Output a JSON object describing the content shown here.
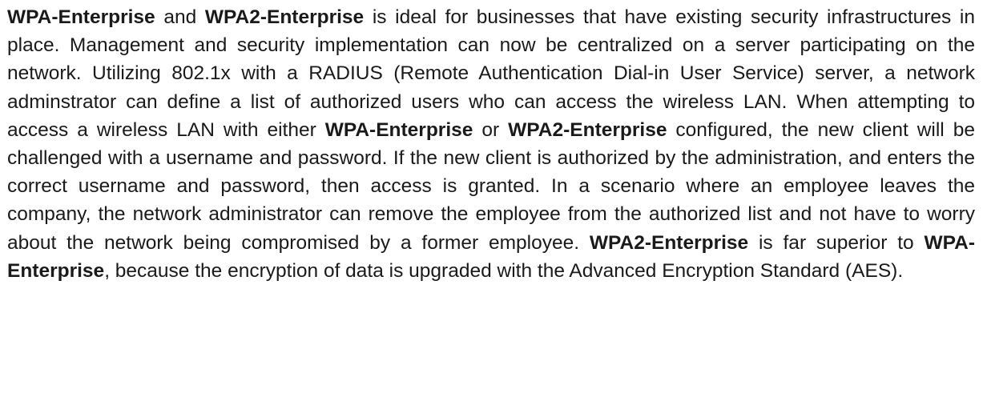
{
  "paragraph": {
    "segments": [
      {
        "text": "WPA-Enterprise",
        "bold": true
      },
      {
        "text": " and ",
        "bold": false
      },
      {
        "text": "WPA2-Enterprise",
        "bold": true
      },
      {
        "text": " is ideal for businesses that have existing security infrastructures in place. Management and security implementation can now be centralized on a server participating on the network. Utilizing 802.1x with a RADIUS (Remote Authentication Dial-in User Service) server, a network adminstrator can define a list of authorized users who can access the wireless LAN. When attempting to access a wireless LAN with either ",
        "bold": false
      },
      {
        "text": "WPA-Enterprise",
        "bold": true
      },
      {
        "text": " or ",
        "bold": false
      },
      {
        "text": "WPA2-Enterprise",
        "bold": true
      },
      {
        "text": " configured, the new client will be challenged with a username and password. If the new client is authorized by the administration, and enters the correct username and password, then access is granted. In a scenario where an employee leaves the company, the network administrator can remove the employee from the authorized list and not have to worry about the network being compromised by a former employee. ",
        "bold": false
      },
      {
        "text": "WPA2-Enterprise",
        "bold": true
      },
      {
        "text": " is far superior to ",
        "bold": false
      },
      {
        "text": "WPA-Enterprise",
        "bold": true
      },
      {
        "text": ", because the encryption of data is upgraded with the Advanced Encryption Standard (AES).",
        "bold": false
      }
    ]
  }
}
